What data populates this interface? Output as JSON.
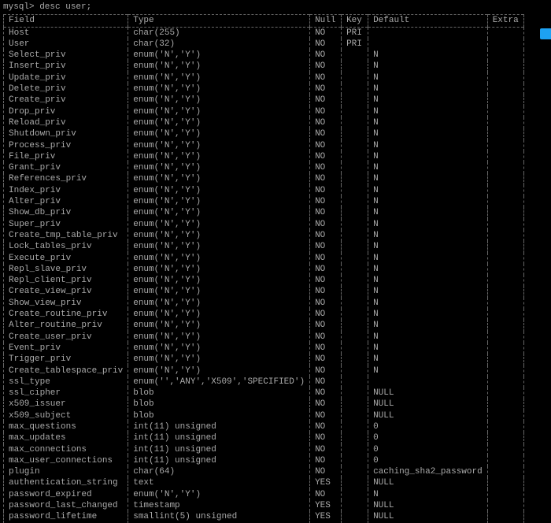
{
  "prompt": "mysql> desc user;",
  "columns": {
    "field": "Field",
    "type": "Type",
    "null": "Null",
    "key": "Key",
    "default": "Default",
    "extra": "Extra"
  },
  "rows": [
    {
      "field": "Host",
      "type": "char(255)",
      "null": "NO",
      "key": "PRI",
      "default": "",
      "extra": ""
    },
    {
      "field": "User",
      "type": "char(32)",
      "null": "NO",
      "key": "PRI",
      "default": "",
      "extra": ""
    },
    {
      "field": "Select_priv",
      "type": "enum('N','Y')",
      "null": "NO",
      "key": "",
      "default": "N",
      "extra": ""
    },
    {
      "field": "Insert_priv",
      "type": "enum('N','Y')",
      "null": "NO",
      "key": "",
      "default": "N",
      "extra": ""
    },
    {
      "field": "Update_priv",
      "type": "enum('N','Y')",
      "null": "NO",
      "key": "",
      "default": "N",
      "extra": ""
    },
    {
      "field": "Delete_priv",
      "type": "enum('N','Y')",
      "null": "NO",
      "key": "",
      "default": "N",
      "extra": ""
    },
    {
      "field": "Create_priv",
      "type": "enum('N','Y')",
      "null": "NO",
      "key": "",
      "default": "N",
      "extra": ""
    },
    {
      "field": "Drop_priv",
      "type": "enum('N','Y')",
      "null": "NO",
      "key": "",
      "default": "N",
      "extra": ""
    },
    {
      "field": "Reload_priv",
      "type": "enum('N','Y')",
      "null": "NO",
      "key": "",
      "default": "N",
      "extra": ""
    },
    {
      "field": "Shutdown_priv",
      "type": "enum('N','Y')",
      "null": "NO",
      "key": "",
      "default": "N",
      "extra": ""
    },
    {
      "field": "Process_priv",
      "type": "enum('N','Y')",
      "null": "NO",
      "key": "",
      "default": "N",
      "extra": ""
    },
    {
      "field": "File_priv",
      "type": "enum('N','Y')",
      "null": "NO",
      "key": "",
      "default": "N",
      "extra": ""
    },
    {
      "field": "Grant_priv",
      "type": "enum('N','Y')",
      "null": "NO",
      "key": "",
      "default": "N",
      "extra": ""
    },
    {
      "field": "References_priv",
      "type": "enum('N','Y')",
      "null": "NO",
      "key": "",
      "default": "N",
      "extra": ""
    },
    {
      "field": "Index_priv",
      "type": "enum('N','Y')",
      "null": "NO",
      "key": "",
      "default": "N",
      "extra": ""
    },
    {
      "field": "Alter_priv",
      "type": "enum('N','Y')",
      "null": "NO",
      "key": "",
      "default": "N",
      "extra": ""
    },
    {
      "field": "Show_db_priv",
      "type": "enum('N','Y')",
      "null": "NO",
      "key": "",
      "default": "N",
      "extra": ""
    },
    {
      "field": "Super_priv",
      "type": "enum('N','Y')",
      "null": "NO",
      "key": "",
      "default": "N",
      "extra": ""
    },
    {
      "field": "Create_tmp_table_priv",
      "type": "enum('N','Y')",
      "null": "NO",
      "key": "",
      "default": "N",
      "extra": ""
    },
    {
      "field": "Lock_tables_priv",
      "type": "enum('N','Y')",
      "null": "NO",
      "key": "",
      "default": "N",
      "extra": ""
    },
    {
      "field": "Execute_priv",
      "type": "enum('N','Y')",
      "null": "NO",
      "key": "",
      "default": "N",
      "extra": ""
    },
    {
      "field": "Repl_slave_priv",
      "type": "enum('N','Y')",
      "null": "NO",
      "key": "",
      "default": "N",
      "extra": ""
    },
    {
      "field": "Repl_client_priv",
      "type": "enum('N','Y')",
      "null": "NO",
      "key": "",
      "default": "N",
      "extra": ""
    },
    {
      "field": "Create_view_priv",
      "type": "enum('N','Y')",
      "null": "NO",
      "key": "",
      "default": "N",
      "extra": ""
    },
    {
      "field": "Show_view_priv",
      "type": "enum('N','Y')",
      "null": "NO",
      "key": "",
      "default": "N",
      "extra": ""
    },
    {
      "field": "Create_routine_priv",
      "type": "enum('N','Y')",
      "null": "NO",
      "key": "",
      "default": "N",
      "extra": ""
    },
    {
      "field": "Alter_routine_priv",
      "type": "enum('N','Y')",
      "null": "NO",
      "key": "",
      "default": "N",
      "extra": ""
    },
    {
      "field": "Create_user_priv",
      "type": "enum('N','Y')",
      "null": "NO",
      "key": "",
      "default": "N",
      "extra": ""
    },
    {
      "field": "Event_priv",
      "type": "enum('N','Y')",
      "null": "NO",
      "key": "",
      "default": "N",
      "extra": ""
    },
    {
      "field": "Trigger_priv",
      "type": "enum('N','Y')",
      "null": "NO",
      "key": "",
      "default": "N",
      "extra": ""
    },
    {
      "field": "Create_tablespace_priv",
      "type": "enum('N','Y')",
      "null": "NO",
      "key": "",
      "default": "N",
      "extra": ""
    },
    {
      "field": "ssl_type",
      "type": "enum('','ANY','X509','SPECIFIED')",
      "null": "NO",
      "key": "",
      "default": "",
      "extra": ""
    },
    {
      "field": "ssl_cipher",
      "type": "blob",
      "null": "NO",
      "key": "",
      "default": "NULL",
      "extra": ""
    },
    {
      "field": "x509_issuer",
      "type": "blob",
      "null": "NO",
      "key": "",
      "default": "NULL",
      "extra": ""
    },
    {
      "field": "x509_subject",
      "type": "blob",
      "null": "NO",
      "key": "",
      "default": "NULL",
      "extra": ""
    },
    {
      "field": "max_questions",
      "type": "int(11) unsigned",
      "null": "NO",
      "key": "",
      "default": "0",
      "extra": ""
    },
    {
      "field": "max_updates",
      "type": "int(11) unsigned",
      "null": "NO",
      "key": "",
      "default": "0",
      "extra": ""
    },
    {
      "field": "max_connections",
      "type": "int(11) unsigned",
      "null": "NO",
      "key": "",
      "default": "0",
      "extra": ""
    },
    {
      "field": "max_user_connections",
      "type": "int(11) unsigned",
      "null": "NO",
      "key": "",
      "default": "0",
      "extra": ""
    },
    {
      "field": "plugin",
      "type": "char(64)",
      "null": "NO",
      "key": "",
      "default": "caching_sha2_password",
      "extra": ""
    },
    {
      "field": "authentication_string",
      "type": "text",
      "null": "YES",
      "key": "",
      "default": "NULL",
      "extra": ""
    },
    {
      "field": "password_expired",
      "type": "enum('N','Y')",
      "null": "NO",
      "key": "",
      "default": "N",
      "extra": ""
    },
    {
      "field": "password_last_changed",
      "type": "timestamp",
      "null": "YES",
      "key": "",
      "default": "NULL",
      "extra": ""
    },
    {
      "field": "password_lifetime",
      "type": "smallint(5) unsigned",
      "null": "YES",
      "key": "",
      "default": "NULL",
      "extra": ""
    }
  ]
}
